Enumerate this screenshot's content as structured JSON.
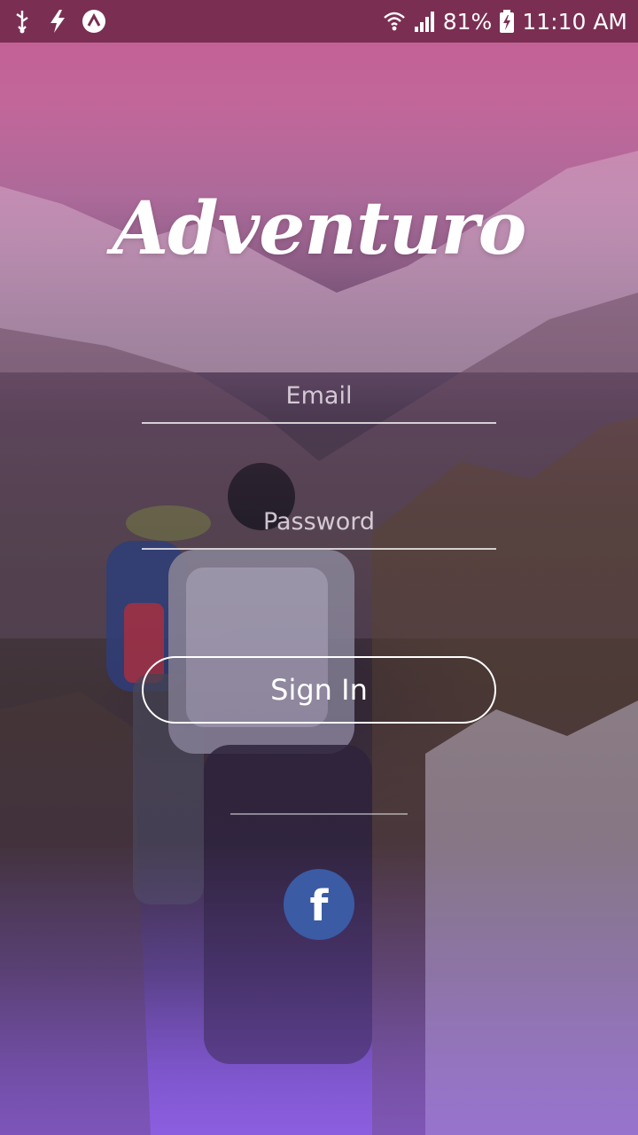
{
  "status_bar": {
    "battery_percent": "81%",
    "time": "11:10 AM",
    "icons": [
      "usb-icon",
      "charging-bolt-icon",
      "app-notification-icon",
      "wifi-icon",
      "signal-icon",
      "battery-icon"
    ]
  },
  "app": {
    "title": "Adventuro"
  },
  "form": {
    "email_placeholder": "Email",
    "password_placeholder": "Password",
    "signin_label": "Sign In"
  },
  "social": {
    "facebook_glyph": "f",
    "facebook_color": "#3b5ba5"
  },
  "colors": {
    "status_bar": "#7a2f52",
    "accent_top": "#b7608f",
    "accent_bottom": "#8a63d8"
  }
}
